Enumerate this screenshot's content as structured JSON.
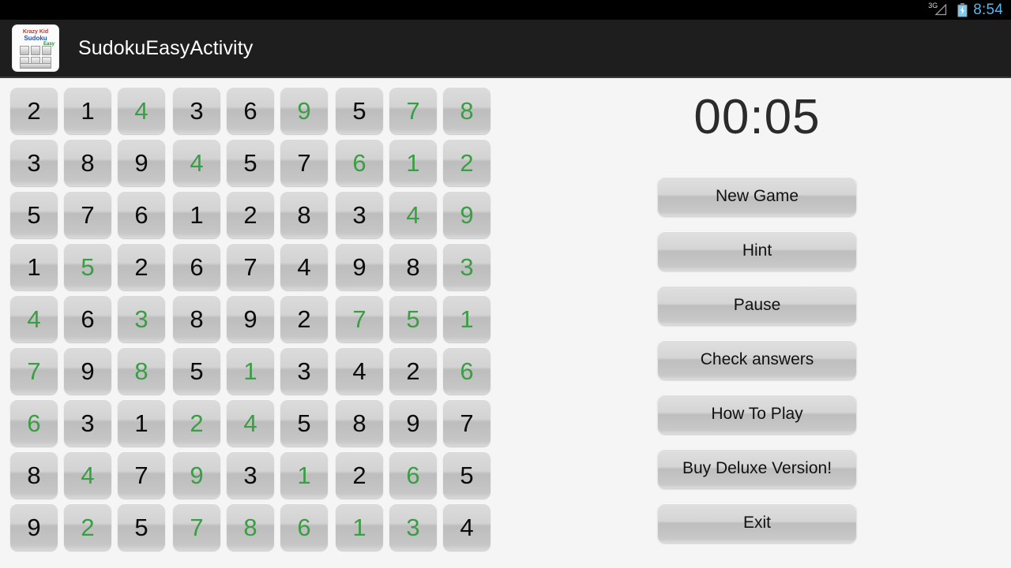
{
  "status_bar": {
    "network_label": "3G",
    "time": "8:54",
    "time_color": "#5ab4e8",
    "battery_state": "charging"
  },
  "action_bar": {
    "title": "SudokuEasyActivity",
    "icon_text_line1": "Krazy Kid",
    "icon_text_line2": "Sudoku",
    "icon_text_line3": "Easy"
  },
  "board": {
    "given_color": "#0b0b0b",
    "user_color": "#3a9e44",
    "rows": [
      [
        {
          "v": "2",
          "user": false
        },
        {
          "v": "1",
          "user": false
        },
        {
          "v": "4",
          "user": true
        },
        {
          "v": "3",
          "user": false
        },
        {
          "v": "6",
          "user": false
        },
        {
          "v": "9",
          "user": true
        },
        {
          "v": "5",
          "user": false
        },
        {
          "v": "7",
          "user": true
        },
        {
          "v": "8",
          "user": true
        }
      ],
      [
        {
          "v": "3",
          "user": false
        },
        {
          "v": "8",
          "user": false
        },
        {
          "v": "9",
          "user": false
        },
        {
          "v": "4",
          "user": true
        },
        {
          "v": "5",
          "user": false
        },
        {
          "v": "7",
          "user": false
        },
        {
          "v": "6",
          "user": true
        },
        {
          "v": "1",
          "user": true
        },
        {
          "v": "2",
          "user": true
        }
      ],
      [
        {
          "v": "5",
          "user": false
        },
        {
          "v": "7",
          "user": false
        },
        {
          "v": "6",
          "user": false
        },
        {
          "v": "1",
          "user": false
        },
        {
          "v": "2",
          "user": false
        },
        {
          "v": "8",
          "user": false
        },
        {
          "v": "3",
          "user": false
        },
        {
          "v": "4",
          "user": true
        },
        {
          "v": "9",
          "user": true
        }
      ],
      [
        {
          "v": "1",
          "user": false
        },
        {
          "v": "5",
          "user": true
        },
        {
          "v": "2",
          "user": false
        },
        {
          "v": "6",
          "user": false
        },
        {
          "v": "7",
          "user": false
        },
        {
          "v": "4",
          "user": false
        },
        {
          "v": "9",
          "user": false
        },
        {
          "v": "8",
          "user": false
        },
        {
          "v": "3",
          "user": true
        }
      ],
      [
        {
          "v": "4",
          "user": true
        },
        {
          "v": "6",
          "user": false
        },
        {
          "v": "3",
          "user": true
        },
        {
          "v": "8",
          "user": false
        },
        {
          "v": "9",
          "user": false
        },
        {
          "v": "2",
          "user": false
        },
        {
          "v": "7",
          "user": true
        },
        {
          "v": "5",
          "user": true
        },
        {
          "v": "1",
          "user": true
        }
      ],
      [
        {
          "v": "7",
          "user": true
        },
        {
          "v": "9",
          "user": false
        },
        {
          "v": "8",
          "user": true
        },
        {
          "v": "5",
          "user": false
        },
        {
          "v": "1",
          "user": true
        },
        {
          "v": "3",
          "user": false
        },
        {
          "v": "4",
          "user": false
        },
        {
          "v": "2",
          "user": false
        },
        {
          "v": "6",
          "user": true
        }
      ],
      [
        {
          "v": "6",
          "user": true
        },
        {
          "v": "3",
          "user": false
        },
        {
          "v": "1",
          "user": false
        },
        {
          "v": "2",
          "user": true
        },
        {
          "v": "4",
          "user": true
        },
        {
          "v": "5",
          "user": false
        },
        {
          "v": "8",
          "user": false
        },
        {
          "v": "9",
          "user": false
        },
        {
          "v": "7",
          "user": false
        }
      ],
      [
        {
          "v": "8",
          "user": false
        },
        {
          "v": "4",
          "user": true
        },
        {
          "v": "7",
          "user": false
        },
        {
          "v": "9",
          "user": true
        },
        {
          "v": "3",
          "user": false
        },
        {
          "v": "1",
          "user": true
        },
        {
          "v": "2",
          "user": false
        },
        {
          "v": "6",
          "user": true
        },
        {
          "v": "5",
          "user": false
        }
      ],
      [
        {
          "v": "9",
          "user": false
        },
        {
          "v": "2",
          "user": true
        },
        {
          "v": "5",
          "user": false
        },
        {
          "v": "7",
          "user": true
        },
        {
          "v": "8",
          "user": true
        },
        {
          "v": "6",
          "user": true
        },
        {
          "v": "1",
          "user": true
        },
        {
          "v": "3",
          "user": true
        },
        {
          "v": "4",
          "user": false
        }
      ]
    ]
  },
  "side_panel": {
    "timer": "00:05",
    "buttons": [
      {
        "label": "New Game",
        "name": "new-game-button"
      },
      {
        "label": "Hint",
        "name": "hint-button"
      },
      {
        "label": "Pause",
        "name": "pause-button"
      },
      {
        "label": "Check answers",
        "name": "check-answers-button"
      },
      {
        "label": "How To Play",
        "name": "how-to-play-button"
      },
      {
        "label": "Buy Deluxe Version!",
        "name": "buy-deluxe-version-button"
      },
      {
        "label": "Exit",
        "name": "exit-button"
      }
    ]
  }
}
